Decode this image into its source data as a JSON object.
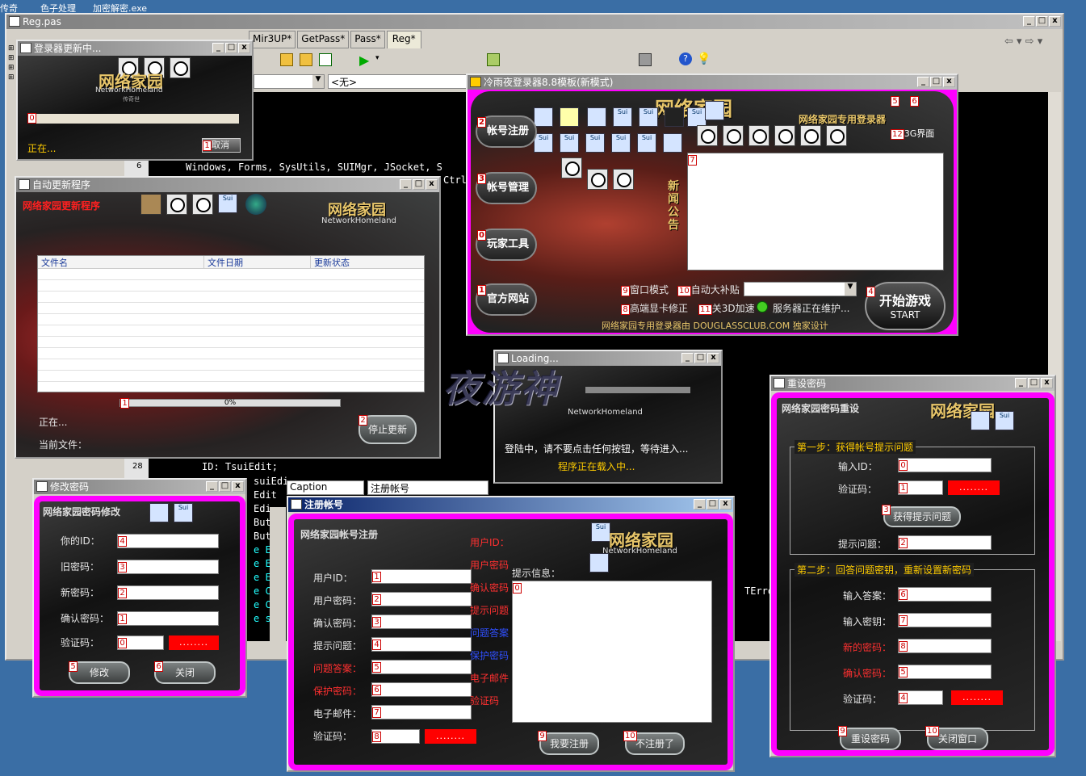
{
  "desktop": {
    "top_icons": [
      "传奇",
      "色子处理",
      "加密解密.exe"
    ]
  },
  "ide": {
    "title": "Reg.pas",
    "tabs": [
      "Mir3UP*",
      "GetPass*",
      "Pass*",
      "Reg*"
    ],
    "combo_value": "<无>",
    "line_numbers": [
      "6",
      "28"
    ],
    "code_lines": [
      "Windows, Forms, SysUtils, SUIMgr, JSocket, S",
      "Ctrl",
      "ID: TsuiEdit;",
      "suiEdi",
      "Edit",
      "Edi",
      "But",
      "But",
      "e Ed",
      "e Ed",
      "e Ed",
      "e Co",
      "e Co",
      "e sui",
      "TErro"
    ],
    "object_inspector": {
      "property": "Caption",
      "value": "注册帐号"
    }
  },
  "updater_login": {
    "title": "登录器更新中...",
    "logo_cn": "网络家园",
    "logo_en": "NetworkHomeland",
    "logo_small": "传奇世",
    "progress_prefix": "0",
    "status": "正在...",
    "cancel_badge": "1",
    "cancel_label": "取消"
  },
  "auto_update": {
    "title": "自动更新程序",
    "header_red": "网络家园更新程序",
    "logo_cn": "网络家园",
    "logo_en": "NetworkHomeland",
    "columns": [
      "文件名",
      "文件日期",
      "更新状态"
    ],
    "progress_prefix": "1",
    "progress_pct": "0%",
    "status_label": "正在...",
    "current_file_label": "当前文件：",
    "stop_badge": "2",
    "stop_label": "停止更新"
  },
  "launcher": {
    "title": "冷雨夜登录器8.8模板(新模式)",
    "logo_cn": "网络家园",
    "logo_sub": "网络家园专用登录器",
    "nav": [
      {
        "badge": "2",
        "label": "帐号注册"
      },
      {
        "badge": "3",
        "label": "帐号管理"
      },
      {
        "badge": "0",
        "label": "玩家工具"
      },
      {
        "badge": "1",
        "label": "官方网站"
      }
    ],
    "top_badges": [
      "5",
      "6"
    ],
    "ui3g_badge": "12",
    "ui3g_label": "3G界面",
    "news_badge": "7",
    "news_label": "新闻公告",
    "opt_window_badge": "9",
    "opt_window": "窗口模式",
    "opt_auto_badge": "10",
    "opt_auto": "自动大补贴",
    "opt_hd_badge": "8",
    "opt_hd": "高端显卡修正",
    "opt_3d_badge": "11",
    "opt_3d": "关3D加速",
    "server_status": "服务器正在维护...",
    "start_badge": "4",
    "start_cn": "开始游戏",
    "start_en": "START",
    "footer": "网络家园专用登录器由 DOUGLASSCLUB.COM 独家设计"
  },
  "loading": {
    "title": "Loading...",
    "watermark": "夜游神",
    "logo_en": "NetworkHomeland",
    "msg1": "登陆中，请不要点击任何按钮，等待进入...",
    "msg2": "程序正在载入中..."
  },
  "change_pwd": {
    "title": "修改密码",
    "header": "网络家园密码修改",
    "fields": [
      {
        "label": "你的ID：",
        "badge": "4"
      },
      {
        "label": "旧密码：",
        "badge": "3"
      },
      {
        "label": "新密码：",
        "badge": "2"
      },
      {
        "label": "确认密码：",
        "badge": "1"
      }
    ],
    "captcha_label": "验证码：",
    "captcha_badge": "0",
    "captcha_value": "........",
    "modify_badge": "5",
    "modify_label": "修改",
    "close_badge": "6",
    "close_label": "关闭"
  },
  "register": {
    "title": "注册帐号",
    "header": "网络家园帐号注册",
    "logo_cn": "网络家园",
    "logo_en": "NetworkHomeland",
    "fields": [
      {
        "label": "用户ID：",
        "badge": "1",
        "red": false
      },
      {
        "label": "用户密码：",
        "badge": "2",
        "red": false
      },
      {
        "label": "确认密码：",
        "badge": "3",
        "red": false
      },
      {
        "label": "提示问题：",
        "badge": "4",
        "red": false
      },
      {
        "label": "问题答案：",
        "badge": "5",
        "red": true
      },
      {
        "label": "保护密码：",
        "badge": "6",
        "red": true
      },
      {
        "label": "电子邮件：",
        "badge": "7",
        "red": false
      }
    ],
    "captcha_label": "验证码：",
    "captcha_badge": "8",
    "captcha_value": "........",
    "hints": [
      {
        "text": "用户ID：",
        "color": "red"
      },
      {
        "text": "用户密码",
        "color": "red"
      },
      {
        "text": "确认密码",
        "color": "red"
      },
      {
        "text": "提示问题",
        "color": "red"
      },
      {
        "text": "问题答案",
        "color": "blue"
      },
      {
        "text": "保护密码",
        "color": "blue"
      },
      {
        "text": "电子邮件",
        "color": "red"
      },
      {
        "text": "验证码",
        "color": "red"
      }
    ],
    "info_label": "提示信息：",
    "info_badge": "0",
    "submit_badge": "9",
    "submit_label": "我要注册",
    "cancel_badge": "10",
    "cancel_label": "不注册了"
  },
  "reset_pwd": {
    "title": "重设密码",
    "header": "网络家园密码重设",
    "logo_cn": "网络家园",
    "step1": "第一步：获得帐号提示问题",
    "id_label": "输入ID：",
    "id_badge": "0",
    "captcha1_label": "验证码：",
    "captcha1_badge": "1",
    "captcha1_value": "........",
    "get_hint_badge": "3",
    "get_hint_label": "获得提示问题",
    "question_label": "提示问题：",
    "question_badge": "2",
    "step2": "第二步：回答问题密钥，重新设置新密码",
    "answer_label": "输入答案：",
    "answer_badge": "6",
    "key_label": "输入密钥：",
    "key_badge": "7",
    "newpwd_label": "新的密码：",
    "newpwd_badge": "8",
    "confirm_label": "确认密码：",
    "confirm_badge": "5",
    "captcha2_label": "验证码：",
    "captcha2_badge": "4",
    "captcha2_value": "........",
    "reset_badge": "9",
    "reset_label": "重设密码",
    "close_badge": "10",
    "close_label": "关闭窗口"
  }
}
